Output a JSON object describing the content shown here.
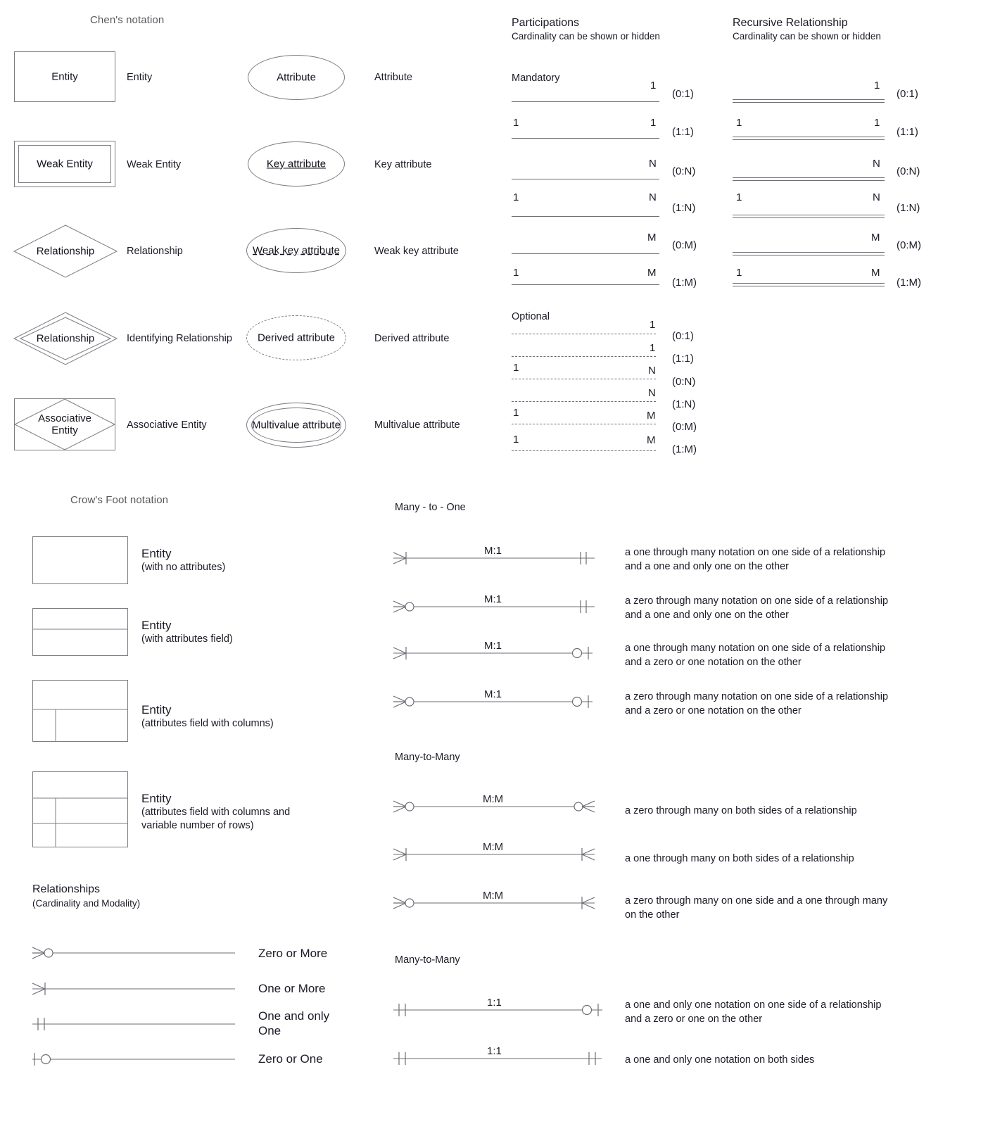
{
  "chen": {
    "title": "Chen's notation",
    "shapes": [
      {
        "shape_label": "Entity",
        "name": "Entity",
        "kind": "rect"
      },
      {
        "shape_label": "Weak Entity",
        "name": "Weak Entity",
        "kind": "double-rect"
      },
      {
        "shape_label": "Relationship",
        "name": "Relationship",
        "kind": "diamond"
      },
      {
        "shape_label": "Relationship",
        "name": "Identifying Relationship",
        "kind": "double-diamond"
      },
      {
        "shape_label": "Associative\nEntity",
        "name": "Associative Entity",
        "kind": "rect-diamond"
      }
    ],
    "attributes": [
      {
        "shape_label": "Attribute",
        "name": "Attribute",
        "kind": "ellipse"
      },
      {
        "shape_label": "Key attribute",
        "name": "Key attribute",
        "kind": "ellipse-underline"
      },
      {
        "shape_label": "Weak key attribute",
        "name": "Weak key attribute",
        "kind": "ellipse-dash-underline"
      },
      {
        "shape_label": "Derived attribute",
        "name": "Derived attribute",
        "kind": "ellipse-dashed"
      },
      {
        "shape_label": "Multivalue attribute",
        "name": "Multivalue attribute",
        "kind": "double-ellipse"
      }
    ]
  },
  "participations": {
    "title": "Participations",
    "subtitle": "Cardinality can be shown or hidden",
    "mandatory_label": "Mandatory",
    "optional_label": "Optional",
    "mandatory": [
      {
        "left": "",
        "right": "1",
        "cardinality": "(0:1)"
      },
      {
        "left": "1",
        "right": "1",
        "cardinality": "(1:1)"
      },
      {
        "left": "",
        "right": "N",
        "cardinality": "(0:N)"
      },
      {
        "left": "1",
        "right": "N",
        "cardinality": "(1:N)"
      },
      {
        "left": "",
        "right": "M",
        "cardinality": "(0:M)"
      },
      {
        "left": "1",
        "right": "M",
        "cardinality": "(1:M)"
      }
    ],
    "optional": [
      {
        "left": "",
        "right": "1",
        "cardinality": "(0:1)"
      },
      {
        "left": "",
        "right": "1",
        "cardinality": "(1:1)"
      },
      {
        "left": "1",
        "right": "N",
        "cardinality": "(0:N)"
      },
      {
        "left": "",
        "right": "N",
        "cardinality": "(1:N)"
      },
      {
        "left": "1",
        "right": "M",
        "cardinality": "(0:M)"
      },
      {
        "left": "1",
        "right": "M",
        "cardinality": "(1:M)"
      }
    ]
  },
  "recursive": {
    "title": "Recursive Relationship",
    "subtitle": "Cardinality can be shown or hidden",
    "rows": [
      {
        "left": "",
        "right": "1",
        "cardinality": "(0:1)"
      },
      {
        "left": "1",
        "right": "1",
        "cardinality": "(1:1)"
      },
      {
        "left": "",
        "right": "N",
        "cardinality": "(0:N)"
      },
      {
        "left": "1",
        "right": "N",
        "cardinality": "(1:N)"
      },
      {
        "left": "",
        "right": "M",
        "cardinality": "(0:M)"
      },
      {
        "left": "1",
        "right": "M",
        "cardinality": "(1:M)"
      }
    ]
  },
  "crowsfoot": {
    "title": "Crow's Foot notation",
    "entities": [
      {
        "name": "Entity",
        "detail": "(with no attributes)",
        "kind": "plain"
      },
      {
        "name": "Entity",
        "detail": "(with attributes field)",
        "kind": "two-row"
      },
      {
        "name": "Entity",
        "detail": "(attributes field with columns)",
        "kind": "two-row-col"
      },
      {
        "name": "Entity",
        "detail": "(attributes field with columns and\nvariable number of rows)",
        "kind": "three-row-col"
      }
    ]
  },
  "relationships": {
    "title": "Relationships",
    "subtitle": "(Cardinality and Modality)",
    "rows": [
      {
        "symbol": "zero-or-more",
        "label": "Zero or More"
      },
      {
        "symbol": "one-or-more",
        "label": "One or More"
      },
      {
        "symbol": "one-and-only-one",
        "label": "One and only\nOne"
      },
      {
        "symbol": "zero-or-one",
        "label": "Zero or One"
      }
    ]
  },
  "many_to_one": {
    "title": "Many - to - One",
    "rows": [
      {
        "mid": "M:1",
        "left_symbol": "one-or-more",
        "right_symbol": "one-and-only-one",
        "desc": "a one through many notation on one side of a relationship\nand a one and only one on the other"
      },
      {
        "mid": "M:1",
        "left_symbol": "zero-or-more",
        "right_symbol": "one-and-only-one",
        "desc": "a zero through many notation on one side of a relationship\nand a one and only one on the other"
      },
      {
        "mid": "M:1",
        "left_symbol": "one-or-more",
        "right_symbol": "zero-or-one",
        "desc": "a one through many notation on one side of a relationship\nand a zero or one notation on the other"
      },
      {
        "mid": "M:1",
        "left_symbol": "zero-or-more",
        "right_symbol": "zero-or-one",
        "desc": "a zero through many notation on one side of a relationship\nand a zero or one notation on the other"
      }
    ]
  },
  "many_to_many": {
    "title": "Many-to-Many",
    "rows": [
      {
        "mid": "M:M",
        "left_symbol": "zero-or-more",
        "right_symbol": "zero-or-more",
        "desc": "a zero through many on both sides of a relationship"
      },
      {
        "mid": "M:M",
        "left_symbol": "one-or-more",
        "right_symbol": "one-or-more",
        "desc": "a one through many on both sides of a relationship"
      },
      {
        "mid": "M:M",
        "left_symbol": "zero-or-more",
        "right_symbol": "one-or-more",
        "desc": "a zero through many on one side and a one through many\non the other"
      }
    ]
  },
  "one_to_one": {
    "title": "Many-to-Many",
    "rows": [
      {
        "mid": "1:1",
        "left_symbol": "one-and-only-one",
        "right_symbol": "zero-or-one",
        "desc": "a one and only one notation on one side of a relationship\nand a zero or one on the other"
      },
      {
        "mid": "1:1",
        "left_symbol": "one-and-only-one",
        "right_symbol": "one-and-only-one",
        "desc": "a one and only one notation on both sides"
      }
    ]
  },
  "colors": {
    "stroke": "#7c7c84",
    "line": "#6d6d75",
    "text": "#1b1b27",
    "heading_gray": "#58585e"
  }
}
